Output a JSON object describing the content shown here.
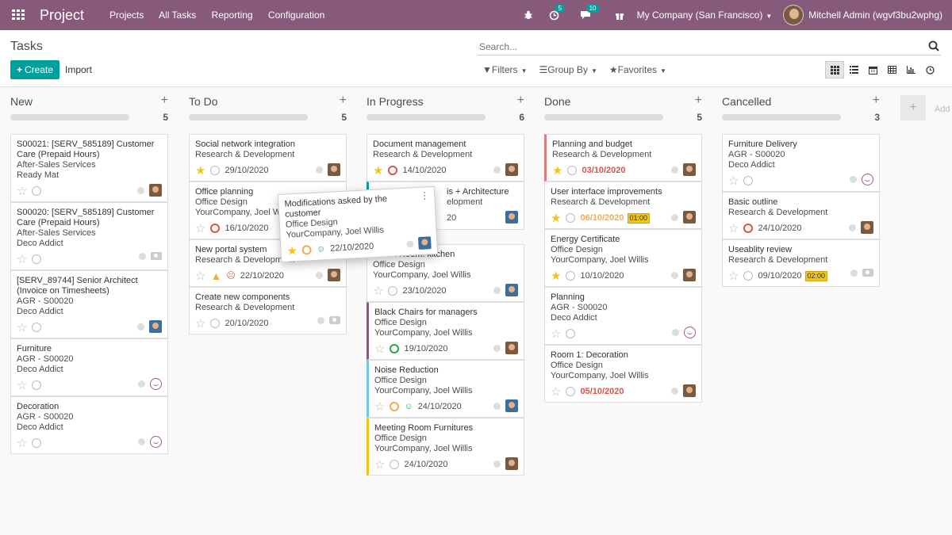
{
  "navbar": {
    "brand": "Project",
    "menu": [
      "Projects",
      "All Tasks",
      "Reporting",
      "Configuration"
    ],
    "badge_activities": "5",
    "badge_messages": "10",
    "company": "My Company (San Francisco)",
    "user": "Mitchell Admin (wgvf3bu2wphg)",
    "bg_color": "#875a7b"
  },
  "control": {
    "breadcrumb": "Tasks",
    "create_label": "Create",
    "import_label": "Import",
    "search_placeholder": "Search...",
    "filters_label": "Filters",
    "groupby_label": "Group By",
    "favorites_label": "Favorites",
    "views": [
      "kanban-icon",
      "list-icon",
      "calendar-icon",
      "pivot-icon",
      "graph-icon",
      "activity-icon"
    ],
    "active_view": "kanban-icon"
  },
  "columns": [
    {
      "title": "New",
      "count": "5",
      "cards": [
        {
          "title": "S00021: [SERV_585189] Customer Care (Prepaid Hours)",
          "lines": [
            "After-Sales Services",
            "Ready Mat"
          ]
        },
        {
          "title": "S00020: [SERV_585189] Customer Care (Prepaid Hours)",
          "lines": [
            "After-Sales Services",
            "Deco Addict"
          ]
        },
        {
          "title": "[SERV_89744] Senior Architect (Invoice on Timesheets)",
          "lines": [
            "AGR - S00020",
            "Deco Addict"
          ]
        },
        {
          "title": "Furniture",
          "lines": [
            "AGR - S00020",
            "Deco Addict"
          ]
        },
        {
          "title": "Decoration",
          "lines": [
            "AGR - S00020",
            "Deco Addict"
          ]
        }
      ]
    },
    {
      "title": "To Do",
      "count": "5",
      "cards": [
        {
          "title": "Social network integration",
          "lines": [
            "Research & Development"
          ],
          "date": "29/10/2020"
        },
        {
          "title": "Office planning",
          "lines": [
            "Office Design",
            "YourCompany, Joel Wi"
          ],
          "date": "16/10/2020"
        },
        {
          "title": "New portal system",
          "lines": [
            "Research & Development"
          ],
          "date": "22/10/2020"
        },
        {
          "title": "Create new components",
          "lines": [
            "Research & Development"
          ],
          "date": "20/10/2020"
        }
      ]
    },
    {
      "title": "In Progress",
      "count": "6",
      "cards": [
        {
          "title": "Document management",
          "lines": [
            "Research & Development"
          ],
          "date": "14/10/2020"
        },
        {
          "title": "is + Architecture",
          "lines": [
            "elopment"
          ],
          "date": "20"
        },
        {
          "title": "Lunch Room: kitchen",
          "lines": [
            "Office Design",
            "YourCompany, Joel Willis"
          ],
          "date": "23/10/2020"
        },
        {
          "title": "Black Chairs for managers",
          "lines": [
            "Office Design",
            "YourCompany, Joel Willis"
          ],
          "date": "19/10/2020"
        },
        {
          "title": "Noise Reduction",
          "lines": [
            "Office Design",
            "YourCompany, Joel Willis"
          ],
          "date": "24/10/2020"
        },
        {
          "title": "Meeting Room Furnitures",
          "lines": [
            "Office Design",
            "YourCompany, Joel Willis"
          ],
          "date": "24/10/2020"
        }
      ]
    },
    {
      "title": "Done",
      "count": "5",
      "cards": [
        {
          "title": "Planning and budget",
          "lines": [
            "Research & Development"
          ],
          "date": "03/10/2020"
        },
        {
          "title": "User interface improvements",
          "lines": [
            "Research & Development"
          ],
          "date": "06/10/2020",
          "time": "01:00"
        },
        {
          "title": "Energy Certificate",
          "lines": [
            "Office Design",
            "YourCompany, Joel Willis"
          ],
          "date": "10/10/2020"
        },
        {
          "title": "Planning",
          "lines": [
            "AGR - S00020",
            "Deco Addict"
          ]
        },
        {
          "title": "Room 1: Decoration",
          "lines": [
            "Office Design",
            "YourCompany, Joel Willis"
          ],
          "date": "05/10/2020"
        }
      ]
    },
    {
      "title": "Cancelled",
      "count": "3",
      "cards": [
        {
          "title": "Furniture Delivery",
          "lines": [
            "AGR - S00020",
            "Deco Addict"
          ]
        },
        {
          "title": "Basic outline",
          "lines": [
            "Research & Development"
          ],
          "date": "24/10/2020"
        },
        {
          "title": "Useablity review",
          "lines": [
            "Research & Development"
          ],
          "date": "09/10/2020",
          "time": "02:00"
        }
      ]
    }
  ],
  "add_column_label": "Add",
  "dragged_card": {
    "title": "Modifications asked by the customer",
    "lines": [
      "Office Design",
      "YourCompany, Joel Willis"
    ],
    "date": "22/10/2020"
  }
}
